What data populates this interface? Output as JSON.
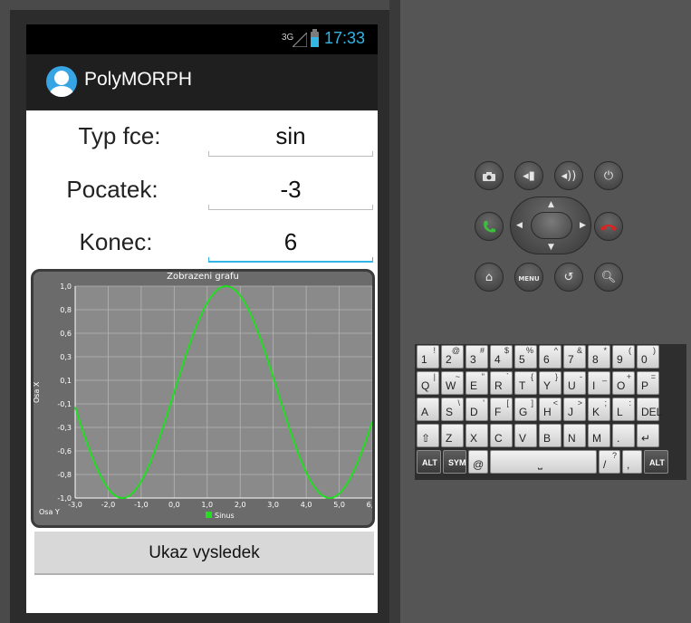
{
  "status_bar": {
    "network": "3G",
    "time": "17:33"
  },
  "app": {
    "title": "PolyMORPH"
  },
  "form": {
    "fields": [
      {
        "label": "Typ fce:",
        "value": "sin"
      },
      {
        "label": "Pocatek:",
        "value": "-3"
      },
      {
        "label": "Konec:",
        "value": "6"
      }
    ]
  },
  "chart_data": {
    "type": "line",
    "title": "Zobrazeni grafu",
    "xlabel": "Osa Y",
    "ylabel": "Osa X",
    "xlim": [
      -3.0,
      6.0
    ],
    "ylim": [
      -1.0,
      1.0
    ],
    "x_ticks": [
      "-3,0",
      "-2,0",
      "-1,0",
      "0,0",
      "1,0",
      "2,0",
      "3,0",
      "4,0",
      "5,0",
      "6,0"
    ],
    "y_ticks": [
      "1,0",
      "0,8",
      "0,6",
      "0,3",
      "0,1",
      "-0,1",
      "-0,3",
      "-0,6",
      "-0,8",
      "-1,0"
    ],
    "grid": true,
    "legend": "bottom-center",
    "series": [
      {
        "name": "Sinus",
        "function": "sin",
        "color": "#22dd22"
      }
    ]
  },
  "button": {
    "label": "Ukaz vysledek"
  },
  "hardware": {
    "buttons": [
      "camera-icon",
      "volume-down-icon",
      "volume-up-icon",
      "power-icon",
      "call-icon",
      "end-call-icon",
      "home-icon",
      "menu-button",
      "back-icon",
      "search-icon"
    ],
    "menu_label": "MENU"
  },
  "keyboard": {
    "rows": [
      [
        [
          "1",
          "!"
        ],
        [
          "2",
          "@"
        ],
        [
          "3",
          "#"
        ],
        [
          "4",
          "$"
        ],
        [
          "5",
          "%"
        ],
        [
          "6",
          "^"
        ],
        [
          "7",
          "&"
        ],
        [
          "8",
          "*"
        ],
        [
          "9",
          "("
        ],
        [
          "0",
          ")"
        ]
      ],
      [
        [
          "Q",
          "|"
        ],
        [
          "W",
          "~"
        ],
        [
          "E",
          "\""
        ],
        [
          "R",
          "`"
        ],
        [
          "T",
          "{"
        ],
        [
          "Y",
          "}"
        ],
        [
          "U",
          "-"
        ],
        [
          "I",
          "_"
        ],
        [
          "O",
          "+"
        ],
        [
          "P",
          "="
        ]
      ],
      [
        [
          "A",
          ""
        ],
        [
          "S",
          "\\"
        ],
        [
          "D",
          "'"
        ],
        [
          "F",
          "["
        ],
        [
          "G",
          "]"
        ],
        [
          "H",
          "<"
        ],
        [
          "J",
          ">"
        ],
        [
          "K",
          ";"
        ],
        [
          "L",
          ":"
        ],
        [
          "DEL",
          ""
        ]
      ],
      [
        [
          "⇧",
          ""
        ],
        [
          "Z",
          ""
        ],
        [
          "X",
          ""
        ],
        [
          "C",
          ""
        ],
        [
          "V",
          ""
        ],
        [
          "B",
          ""
        ],
        [
          "N",
          ""
        ],
        [
          "M",
          ""
        ],
        [
          ".",
          ""
        ],
        [
          "↵",
          ""
        ]
      ],
      [
        [
          "ALT",
          ""
        ],
        [
          "SYM",
          ""
        ],
        [
          "@",
          ""
        ],
        [
          "",
          ""
        ],
        [
          "/",
          "?"
        ],
        [
          ",",
          ""
        ],
        [
          "ALT",
          ""
        ]
      ]
    ]
  }
}
